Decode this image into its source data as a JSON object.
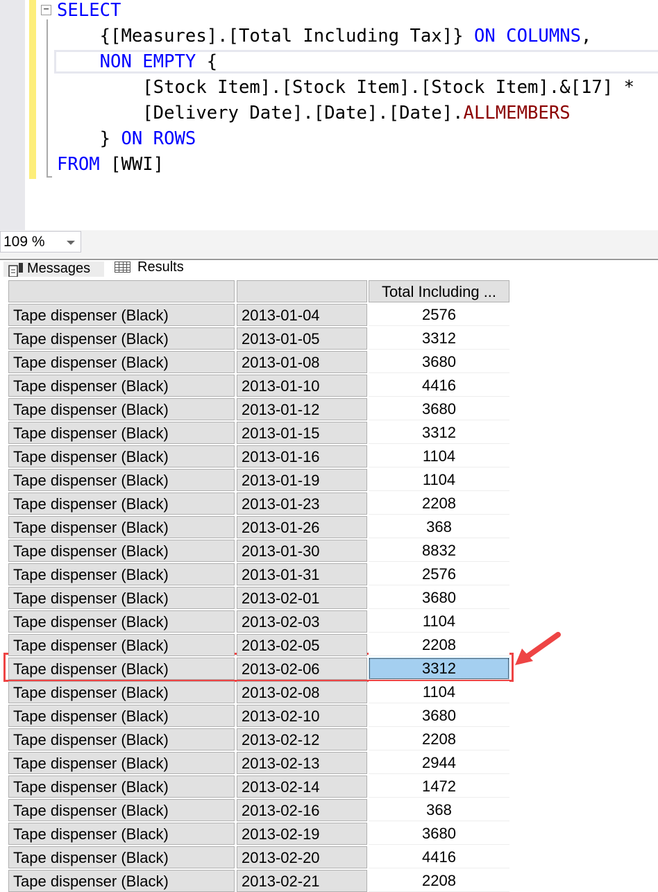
{
  "editor": {
    "lines": [
      [
        {
          "t": "SELECT",
          "c": "kw"
        }
      ],
      [
        {
          "t": "    {[Measures].[Total Including Tax]} "
        },
        {
          "t": "ON COLUMNS",
          "c": "kw"
        },
        {
          "t": ","
        }
      ],
      [
        {
          "t": "    "
        },
        {
          "t": "NON EMPTY",
          "c": "kw"
        },
        {
          "t": " {"
        }
      ],
      [
        {
          "t": "        [Stock Item].[Stock Item].[Stock Item].&[17] *"
        }
      ],
      [
        {
          "t": "        [Delivery Date].[Date].[Date]."
        },
        {
          "t": "ALLMEMBERS",
          "c": "fn"
        }
      ],
      [
        {
          "t": "    } "
        },
        {
          "t": "ON ROWS",
          "c": "kw"
        }
      ],
      [
        {
          "t": "FROM",
          "c": "kw"
        },
        {
          "t": " [WWI]"
        }
      ]
    ]
  },
  "zoom": {
    "value": "109 %"
  },
  "tabs": {
    "messages": "Messages",
    "results": "Results"
  },
  "grid": {
    "columns": [
      "",
      "",
      "Total Including ..."
    ],
    "selected_row": 15,
    "rows": [
      [
        "Tape dispenser (Black)",
        "2013-01-04",
        "2576"
      ],
      [
        "Tape dispenser (Black)",
        "2013-01-05",
        "3312"
      ],
      [
        "Tape dispenser (Black)",
        "2013-01-08",
        "3680"
      ],
      [
        "Tape dispenser (Black)",
        "2013-01-10",
        "4416"
      ],
      [
        "Tape dispenser (Black)",
        "2013-01-12",
        "3680"
      ],
      [
        "Tape dispenser (Black)",
        "2013-01-15",
        "3312"
      ],
      [
        "Tape dispenser (Black)",
        "2013-01-16",
        "1104"
      ],
      [
        "Tape dispenser (Black)",
        "2013-01-19",
        "1104"
      ],
      [
        "Tape dispenser (Black)",
        "2013-01-23",
        "2208"
      ],
      [
        "Tape dispenser (Black)",
        "2013-01-26",
        "368"
      ],
      [
        "Tape dispenser (Black)",
        "2013-01-30",
        "8832"
      ],
      [
        "Tape dispenser (Black)",
        "2013-01-31",
        "2576"
      ],
      [
        "Tape dispenser (Black)",
        "2013-02-01",
        "3680"
      ],
      [
        "Tape dispenser (Black)",
        "2013-02-03",
        "1104"
      ],
      [
        "Tape dispenser (Black)",
        "2013-02-05",
        "2208"
      ],
      [
        "Tape dispenser (Black)",
        "2013-02-06",
        "3312"
      ],
      [
        "Tape dispenser (Black)",
        "2013-02-08",
        "1104"
      ],
      [
        "Tape dispenser (Black)",
        "2013-02-10",
        "3680"
      ],
      [
        "Tape dispenser (Black)",
        "2013-02-12",
        "2208"
      ],
      [
        "Tape dispenser (Black)",
        "2013-02-13",
        "2944"
      ],
      [
        "Tape dispenser (Black)",
        "2013-02-14",
        "1472"
      ],
      [
        "Tape dispenser (Black)",
        "2013-02-16",
        "368"
      ],
      [
        "Tape dispenser (Black)",
        "2013-02-19",
        "3680"
      ],
      [
        "Tape dispenser (Black)",
        "2013-02-20",
        "4416"
      ],
      [
        "Tape dispenser (Black)",
        "2013-02-21",
        "2208"
      ]
    ]
  },
  "colors": {
    "highlight": "#ee4444",
    "selection": "#a4cff0"
  }
}
